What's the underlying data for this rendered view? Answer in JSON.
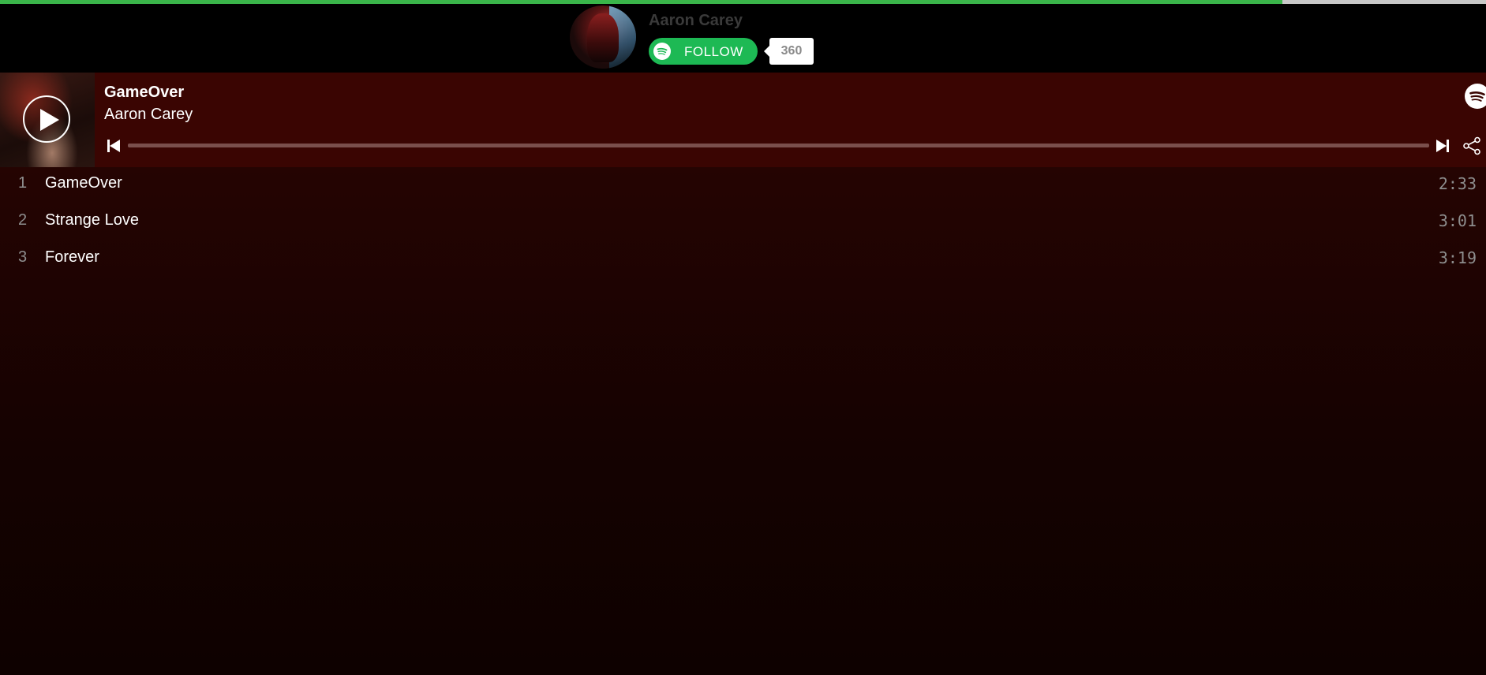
{
  "loading": {
    "progress": 0.863
  },
  "header": {
    "artist_name": "Aaron Carey",
    "follow_label": "FOLLOW",
    "follower_count": "360",
    "icons": {
      "logo": "spotify-logo-icon",
      "avatar": "artist-avatar"
    }
  },
  "player": {
    "track_title": "GameOver",
    "artist_name": "Aaron Carey",
    "progress": 0,
    "icons": {
      "play": "play-icon",
      "previous": "skip-previous-icon",
      "next": "skip-next-icon",
      "share": "share-icon",
      "brand": "spotify-logo-icon"
    }
  },
  "tracks": [
    {
      "number": "1",
      "title": "GameOver",
      "duration": "2:33"
    },
    {
      "number": "2",
      "title": "Strange Love",
      "duration": "3:01"
    },
    {
      "number": "3",
      "title": "Forever",
      "duration": "3:19"
    }
  ],
  "colors": {
    "accent_green": "#1db954",
    "loading_green": "#3ab54a",
    "player_bg": "#3a0502",
    "list_bg": "#250402"
  }
}
